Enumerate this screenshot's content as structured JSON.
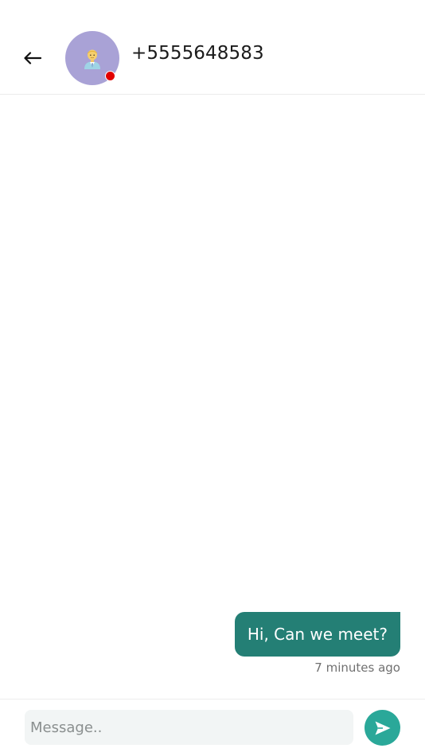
{
  "header": {
    "back_icon": "arrow-left-icon",
    "avatar_icon": "person-avatar-icon",
    "avatar_color": "#a9a2d6",
    "status_color": "#e20000",
    "contact_name": "+5555648583"
  },
  "messages": [
    {
      "text": "Hi, Can we meet?",
      "time": "7 minutes ago",
      "outgoing": true,
      "bubble_color": "#247f75"
    }
  ],
  "composer": {
    "placeholder": "Message..",
    "value": "",
    "send_icon": "send-icon",
    "send_color": "#2aa899"
  }
}
